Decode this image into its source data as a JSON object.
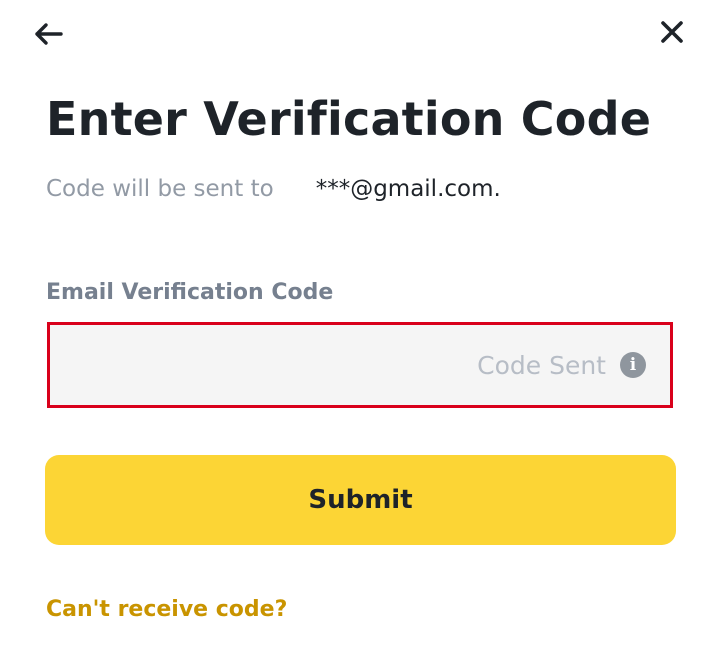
{
  "header": {
    "back_icon": "arrow-left-icon",
    "close_icon": "close-x-icon"
  },
  "main": {
    "title": "Enter Verification Code",
    "sent_to_label": "Code will be sent to",
    "sent_to_email": "***@gmail.com.",
    "field_label": "Email Verification Code",
    "code_input_value": "",
    "code_status": "Code Sent",
    "info_icon": "info-icon",
    "submit_label": "Submit",
    "help_link": "Can't receive code?"
  },
  "colors": {
    "accent_yellow": "#fcd535",
    "link_gold": "#c99400",
    "highlight_red": "#d9001b",
    "text_dark": "#1e2329",
    "text_muted": "#929aa5"
  }
}
